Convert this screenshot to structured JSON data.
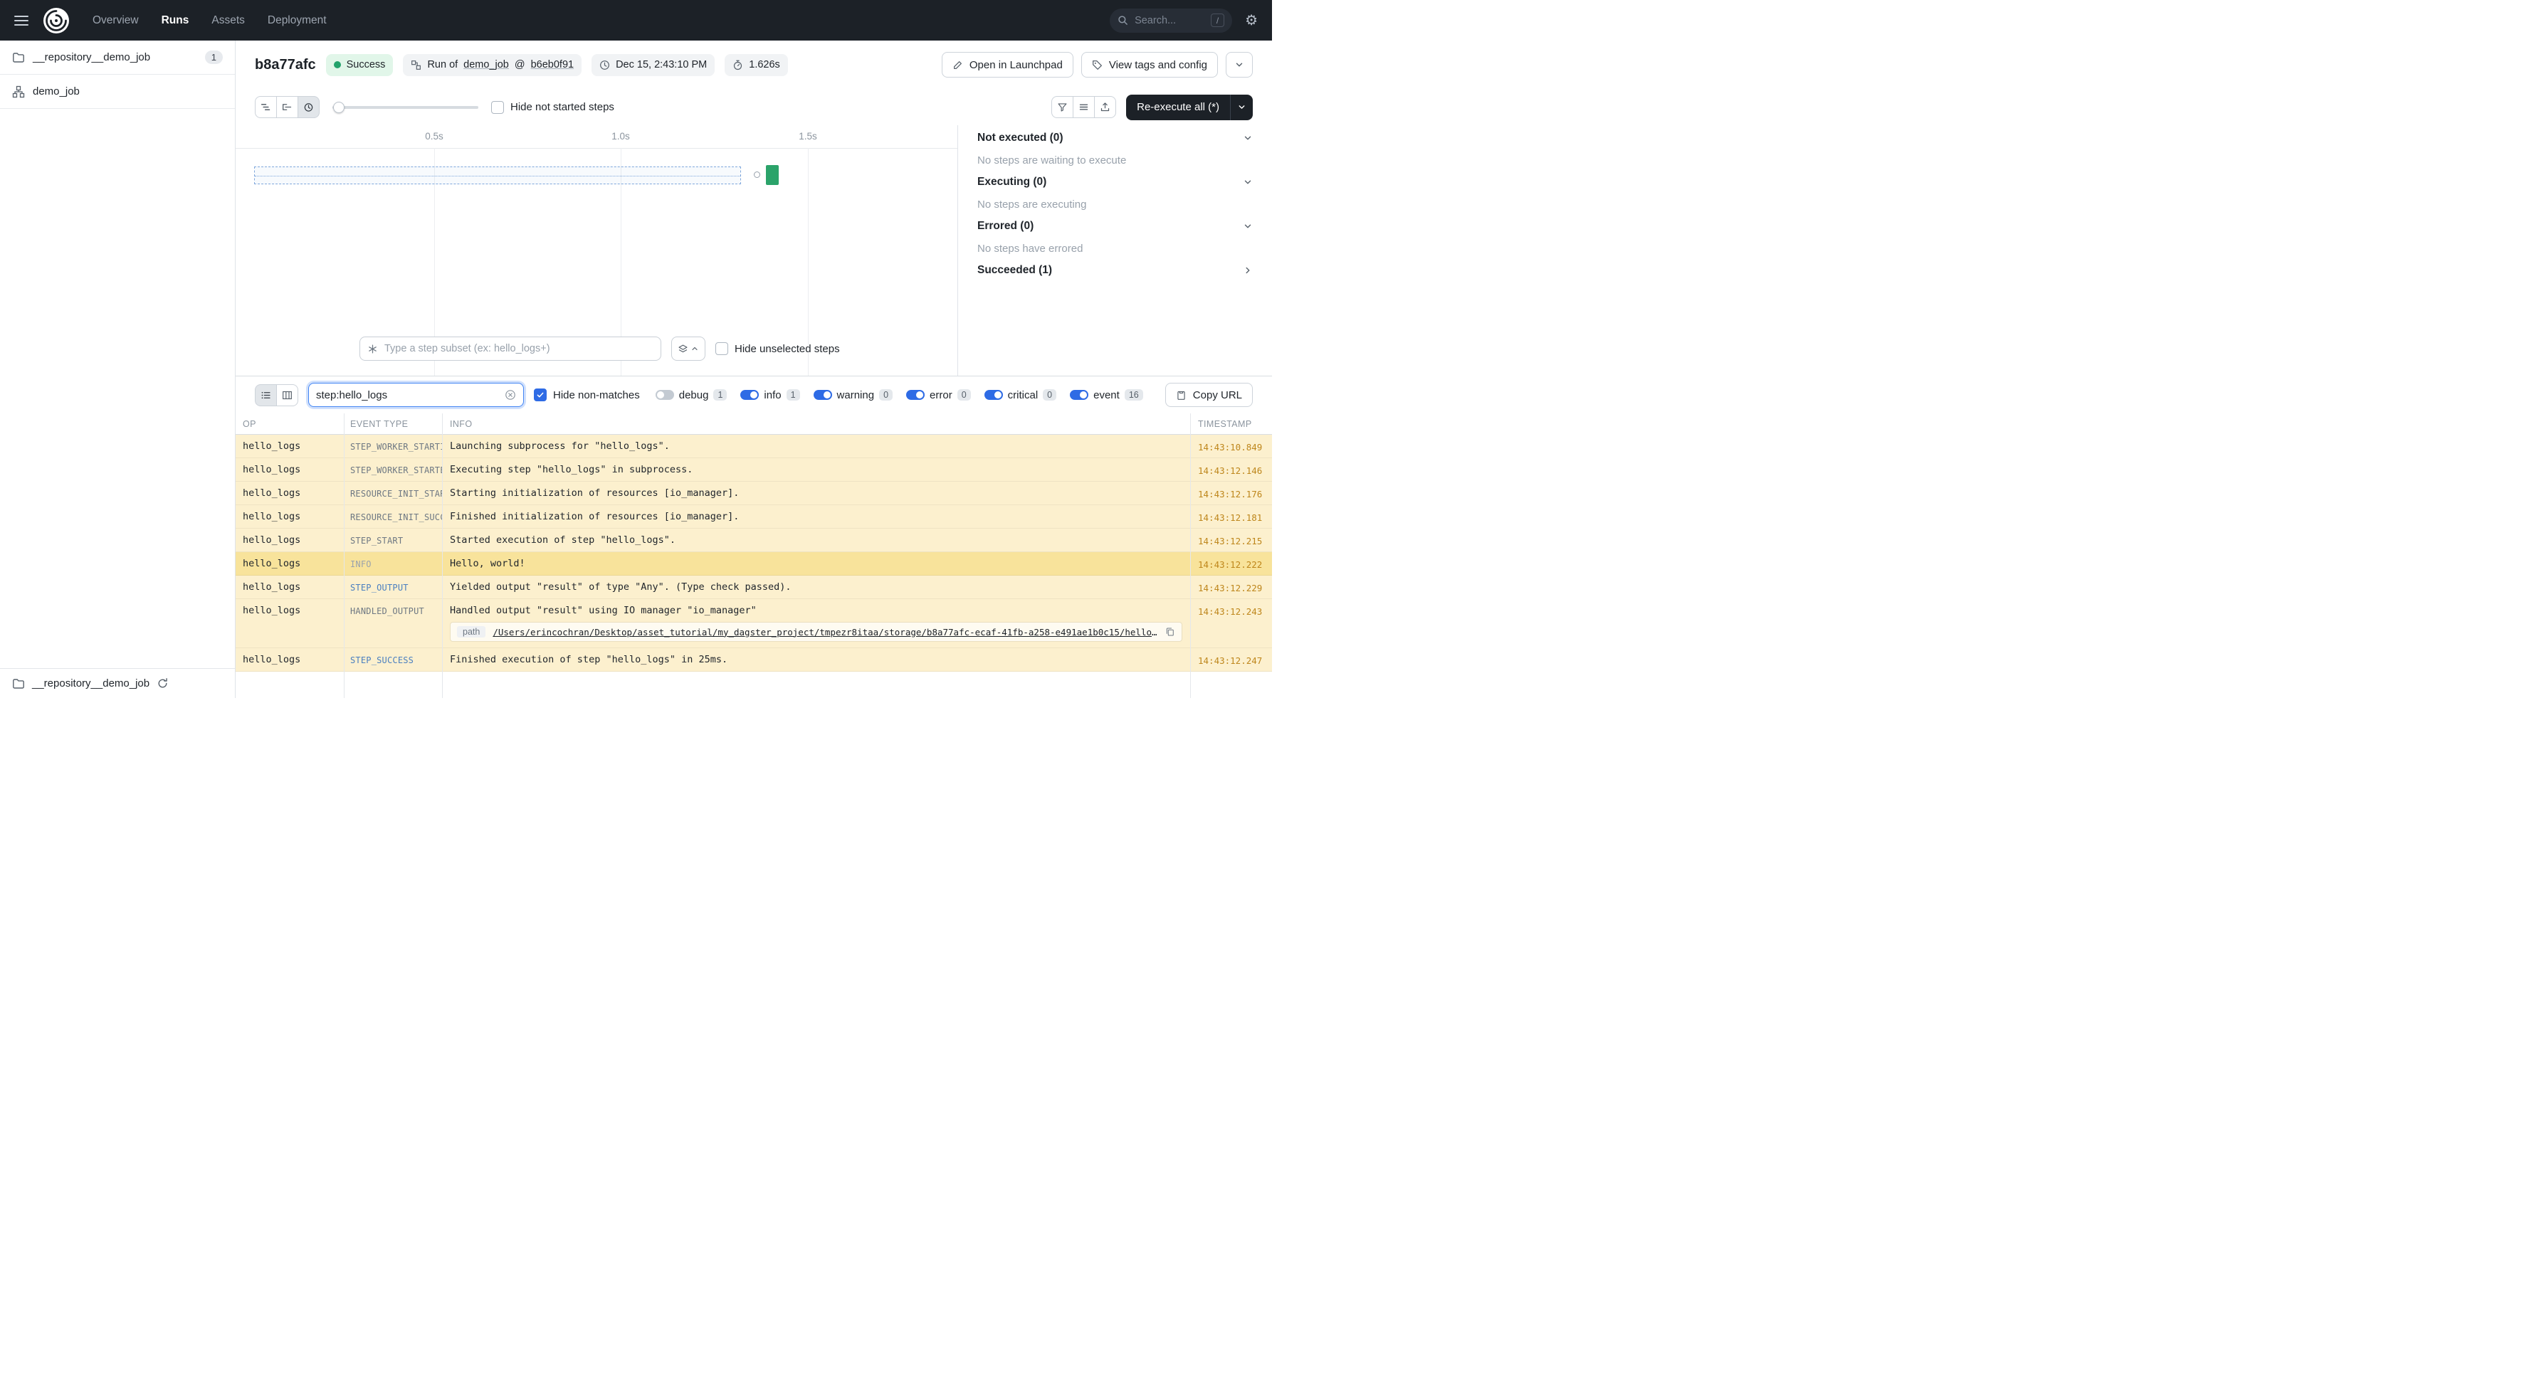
{
  "colors": {
    "navbar": "#1C2127",
    "accent_blue": "#2E6BE5",
    "success_green": "#23A26B",
    "row_highlight": "#FCF0CE",
    "row_highlight_strong": "#F8E39B",
    "timestamp_orange": "#BE861B"
  },
  "nav": {
    "items": [
      {
        "label": "Overview"
      },
      {
        "label": "Runs",
        "active": true
      },
      {
        "label": "Assets"
      },
      {
        "label": "Deployment"
      }
    ],
    "search_placeholder": "Search...",
    "search_kbd": "/",
    "gear_glyph": "⚙"
  },
  "sidebar": {
    "repo": {
      "label": "__repository__demo_job",
      "badge": "1"
    },
    "job": {
      "label": "demo_job"
    },
    "bottom_repo": {
      "label": "__repository__demo_job"
    }
  },
  "header": {
    "run_id": "b8a77afc",
    "status": "Success",
    "run_of_prefix": "Run of",
    "job_link": "demo_job",
    "at": "@",
    "snapshot_link": "b6eb0f91",
    "datetime": "Dec 15, 2:43:10 PM",
    "duration": "1.626s",
    "open_launchpad": "Open in Launchpad",
    "view_tags": "View tags and config"
  },
  "gantt": {
    "toolbar": {
      "hide_not_started": "Hide not started steps",
      "reexecute": "Re-execute all (*)"
    },
    "axis_ticks": [
      "0.5s",
      "1.0s",
      "1.5s"
    ],
    "subset_placeholder": "Type a step subset (ex: hello_logs+)",
    "hide_unselected": "Hide unselected steps"
  },
  "status_panel": {
    "sections": [
      {
        "title": "Not executed (0)",
        "body": "No steps are waiting to execute"
      },
      {
        "title": "Executing (0)",
        "body": "No steps are executing"
      },
      {
        "title": "Errored (0)",
        "body": "No steps have errored"
      },
      {
        "title": "Succeeded (1)",
        "body": ""
      }
    ]
  },
  "logs": {
    "filter_value": "step:hello_logs",
    "hide_non_matches": "Hide non-matches",
    "levels": [
      {
        "label": "debug",
        "count": "1",
        "on": false
      },
      {
        "label": "info",
        "count": "1",
        "on": true
      },
      {
        "label": "warning",
        "count": "0",
        "on": true
      },
      {
        "label": "error",
        "count": "0",
        "on": true
      },
      {
        "label": "critical",
        "count": "0",
        "on": true
      },
      {
        "label": "event",
        "count": "16",
        "on": true
      }
    ],
    "copy_url": "Copy URL",
    "columns": [
      "OP",
      "EVENT TYPE",
      "INFO",
      "TIMESTAMP"
    ],
    "rows": [
      {
        "op": "hello_logs",
        "type": "STEP_WORKER_STARTI…",
        "info": "Launching subprocess for \"hello_logs\".",
        "ts": "14:43:10.849"
      },
      {
        "op": "hello_logs",
        "type": "STEP_WORKER_STARTED",
        "info": "Executing step \"hello_logs\" in subprocess.",
        "ts": "14:43:12.146"
      },
      {
        "op": "hello_logs",
        "type": "RESOURCE_INIT_STAR…",
        "info": "Starting initialization of resources [io_manager].",
        "ts": "14:43:12.176"
      },
      {
        "op": "hello_logs",
        "type": "RESOURCE_INIT_SUCC…",
        "info": "Finished initialization of resources [io_manager].",
        "ts": "14:43:12.181"
      },
      {
        "op": "hello_logs",
        "type": "STEP_START",
        "info": "Started execution of step \"hello_logs\".",
        "ts": "14:43:12.215"
      },
      {
        "op": "hello_logs",
        "type": "INFO",
        "info": "Hello, world!",
        "ts": "14:43:12.222"
      },
      {
        "op": "hello_logs",
        "type": "STEP_OUTPUT",
        "info": "Yielded output \"result\" of type \"Any\". (Type check passed).",
        "ts": "14:43:12.229"
      },
      {
        "op": "hello_logs",
        "type": "HANDLED_OUTPUT",
        "info": "Handled output \"result\" using IO manager \"io_manager\"",
        "ts": "14:43:12.243",
        "path_label": "path",
        "path": "/Users/erincochran/Desktop/asset_tutorial/my_dagster_project/tmpezr8itaa/storage/b8a77afc-ecaf-41fb-a258-e491ae1b0c15/hello_logs/result"
      },
      {
        "op": "hello_logs",
        "type": "STEP_SUCCESS",
        "info": "Finished execution of step \"hello_logs\" in 25ms.",
        "ts": "14:43:12.247"
      }
    ]
  }
}
